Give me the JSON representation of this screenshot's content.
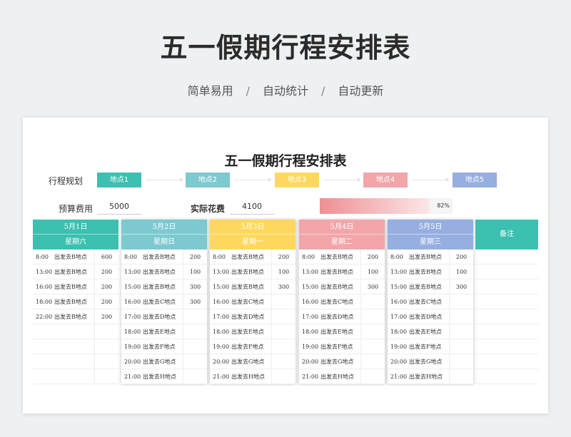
{
  "header": {
    "title": "五一假期行程安排表",
    "subtitle": [
      "简单易用",
      "自动统计",
      "自动更新"
    ],
    "separator": "/"
  },
  "sheet": {
    "title": "五一假期行程安排表",
    "plan_label": "行程规划",
    "places": [
      {
        "label": "地点1",
        "color": "#3cc0b0"
      },
      {
        "label": "地点2",
        "color": "#7dc9d0"
      },
      {
        "label": "地点3",
        "color": "#fdd85d"
      },
      {
        "label": "地点4",
        "color": "#f2a6aa"
      },
      {
        "label": "地点5",
        "color": "#97aee0"
      }
    ],
    "budget_label": "预算费用",
    "budget_value": "5000",
    "actual_label": "实际花费",
    "actual_value": "4100",
    "progress_text": "82%",
    "progress_fraction": 0.82
  },
  "days": [
    {
      "date": "5月1日",
      "weekday": "星期六",
      "color": "#3cc0b0",
      "rows": [
        {
          "time": "8:00",
          "activity": "出发去B地点",
          "cost": "600"
        },
        {
          "time": "13:00",
          "activity": "出发去B地点",
          "cost": "200"
        },
        {
          "time": "16:00",
          "activity": "出发去B地点",
          "cost": "200"
        },
        {
          "time": "18:00",
          "activity": "出发去B地点",
          "cost": "200"
        },
        {
          "time": "22:00",
          "activity": "出发去B地点",
          "cost": "200"
        },
        {
          "time": "",
          "activity": "",
          "cost": ""
        },
        {
          "time": "",
          "activity": "",
          "cost": ""
        },
        {
          "time": "",
          "activity": "",
          "cost": ""
        },
        {
          "time": "",
          "activity": "",
          "cost": ""
        }
      ]
    },
    {
      "date": "5月2日",
      "weekday": "星期日",
      "color": "#7dc9d0",
      "rows": [
        {
          "time": "8:00",
          "activity": "出发去B地点",
          "cost": "200"
        },
        {
          "time": "13:00",
          "activity": "出发去B地点",
          "cost": "100"
        },
        {
          "time": "15:00",
          "activity": "出发去B地点",
          "cost": "300"
        },
        {
          "time": "16:00",
          "activity": "出发去C地点",
          "cost": "300"
        },
        {
          "time": "17:00",
          "activity": "出发去D地点",
          "cost": ""
        },
        {
          "time": "18:00",
          "activity": "出发去E地点",
          "cost": ""
        },
        {
          "time": "19:00",
          "activity": "出发去F地点",
          "cost": ""
        },
        {
          "time": "20:00",
          "activity": "出发去G地点",
          "cost": ""
        },
        {
          "time": "21:00",
          "activity": "出发去H地点",
          "cost": ""
        }
      ]
    },
    {
      "date": "5月3日",
      "weekday": "星期一",
      "color": "#fdd85d",
      "rows": [
        {
          "time": "8:00",
          "activity": "出发去B地点",
          "cost": "200"
        },
        {
          "time": "13:00",
          "activity": "出发去B地点",
          "cost": "100"
        },
        {
          "time": "15:00",
          "activity": "出发去B地点",
          "cost": "300"
        },
        {
          "time": "16:00",
          "activity": "出发去C地点",
          "cost": ""
        },
        {
          "time": "17:00",
          "activity": "出发去D地点",
          "cost": ""
        },
        {
          "time": "18:00",
          "activity": "出发去E地点",
          "cost": ""
        },
        {
          "time": "19:00",
          "activity": "出发去F地点",
          "cost": ""
        },
        {
          "time": "20:00",
          "activity": "出发去G地点",
          "cost": ""
        },
        {
          "time": "21:00",
          "activity": "出发去H地点",
          "cost": ""
        }
      ]
    },
    {
      "date": "5月4日",
      "weekday": "星期二",
      "color": "#f2a6aa",
      "rows": [
        {
          "time": "8:00",
          "activity": "出发去B地点",
          "cost": "200"
        },
        {
          "time": "13:00",
          "activity": "出发去B地点",
          "cost": "100"
        },
        {
          "time": "15:00",
          "activity": "出发去B地点",
          "cost": "300"
        },
        {
          "time": "16:00",
          "activity": "出发去C地点",
          "cost": ""
        },
        {
          "time": "17:00",
          "activity": "出发去D地点",
          "cost": ""
        },
        {
          "time": "18:00",
          "activity": "出发去E地点",
          "cost": ""
        },
        {
          "time": "19:00",
          "activity": "出发去F地点",
          "cost": ""
        },
        {
          "time": "20:00",
          "activity": "出发去G地点",
          "cost": ""
        },
        {
          "time": "21:00",
          "activity": "出发去H地点",
          "cost": ""
        }
      ]
    },
    {
      "date": "5月5日",
      "weekday": "星期三",
      "color": "#97aee0",
      "rows": [
        {
          "time": "8:00",
          "activity": "出发去B地点",
          "cost": "200"
        },
        {
          "time": "13:00",
          "activity": "出发去B地点",
          "cost": "100"
        },
        {
          "time": "15:00",
          "activity": "出发去B地点",
          "cost": "300"
        },
        {
          "time": "16:00",
          "activity": "出发去C地点",
          "cost": ""
        },
        {
          "time": "17:00",
          "activity": "出发去D地点",
          "cost": ""
        },
        {
          "time": "18:00",
          "activity": "出发去E地点",
          "cost": ""
        },
        {
          "time": "19:00",
          "activity": "出发去F地点",
          "cost": ""
        },
        {
          "time": "20:00",
          "activity": "出发去G地点",
          "cost": ""
        },
        {
          "time": "21:00",
          "activity": "出发去H地点",
          "cost": ""
        }
      ]
    }
  ],
  "notes": {
    "label": "备注",
    "color": "#3cc0b0"
  }
}
